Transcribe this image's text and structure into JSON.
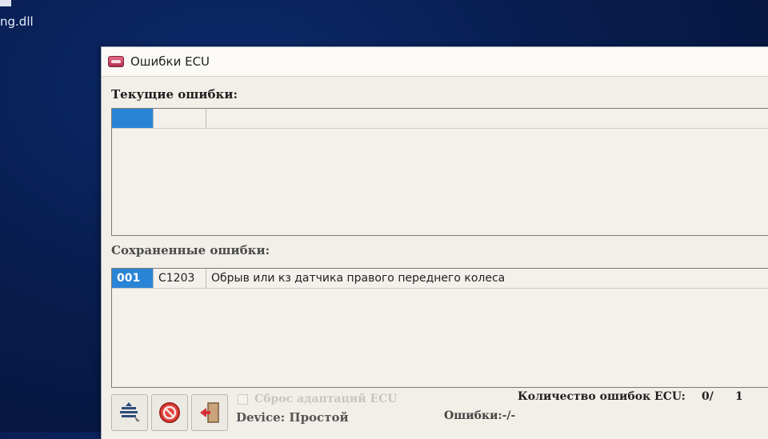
{
  "desktop": {
    "file_label": "ng.dll"
  },
  "window": {
    "title": "Ошибки ECU"
  },
  "current_errors": {
    "title": "Текущие ошибки:",
    "rows": [
      {
        "num": "",
        "code": "",
        "description": ""
      }
    ]
  },
  "saved_errors": {
    "title": "Сохраненные ошибки:",
    "rows": [
      {
        "num": "001",
        "code": "C1203",
        "description": "Обрыв или кз датчика правого переднего колеса"
      }
    ]
  },
  "footer": {
    "reset_adaptation_label": "Сброс адаптаций ECU",
    "device_label": "Device: Простой",
    "errors_label": "Ошибки:-/-",
    "count_label": "Количество ошибок ECU:",
    "count_value_1": "0/",
    "count_value_2": "1"
  },
  "icons": [
    "app-icon",
    "scan-icon",
    "clear-errors-icon",
    "exit-door-icon"
  ],
  "colors": {
    "selection": "#2a84d6",
    "desktop_bg": "#081d4f"
  }
}
